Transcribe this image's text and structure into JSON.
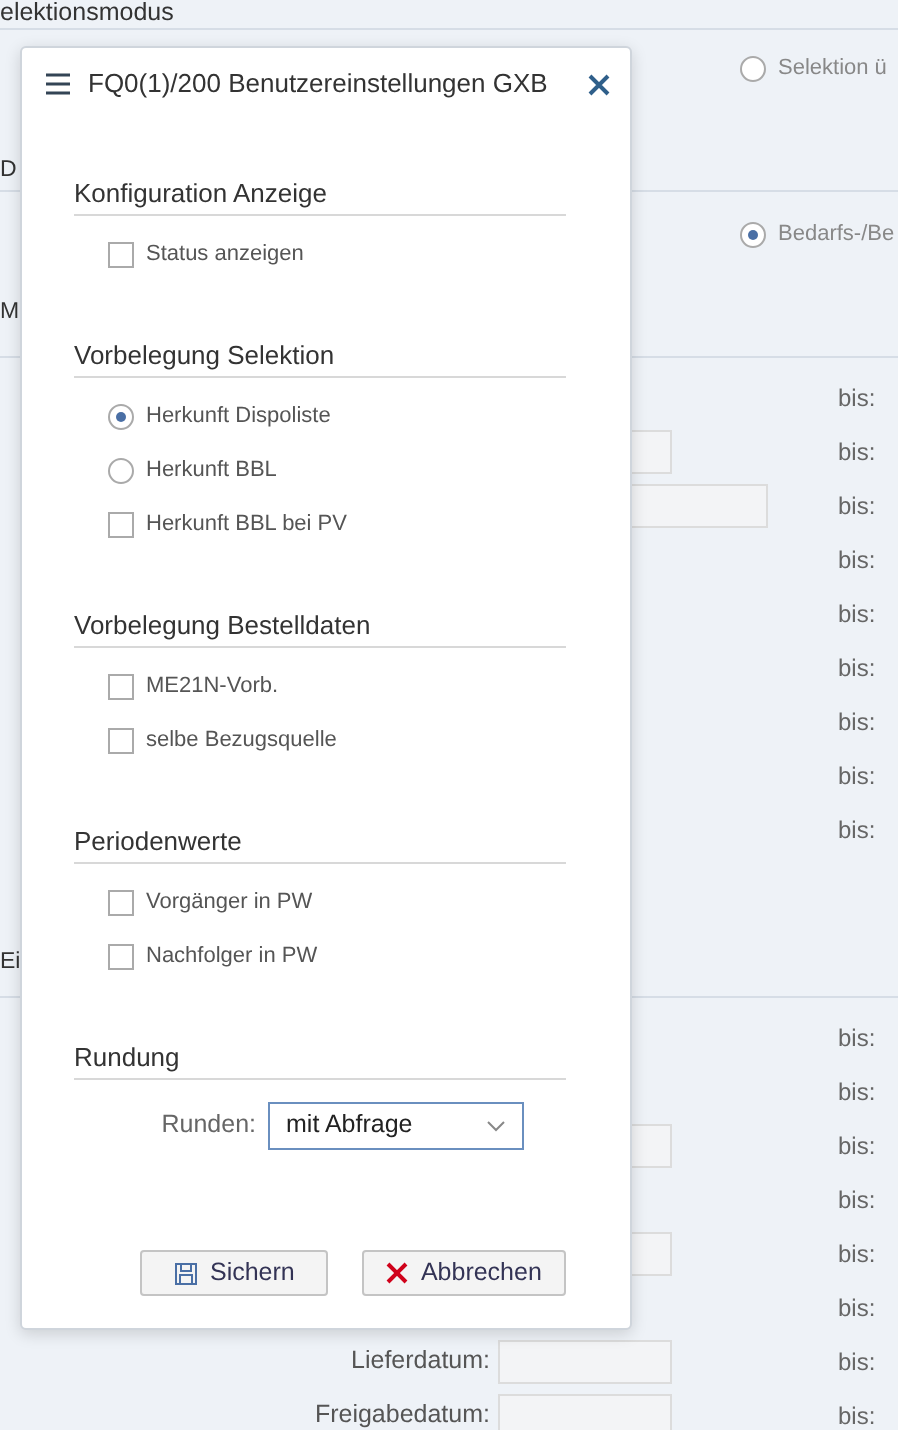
{
  "background": {
    "title": "elektionsmodus",
    "side_labels": [
      "D",
      "M",
      "Ei"
    ],
    "radios": [
      {
        "label": "Selektion ü",
        "selected": false
      },
      {
        "label": "Bedarfs-/Be",
        "selected": true
      }
    ],
    "rows_1": [
      {
        "to": "bis:"
      },
      {
        "to": "bis:",
        "kind": "short_field"
      },
      {
        "to": "bis:",
        "kind": "long_field"
      },
      {
        "to": "bis:"
      },
      {
        "to": "bis:"
      },
      {
        "to": "bis:"
      },
      {
        "to": "bis:"
      },
      {
        "to": "bis:"
      },
      {
        "to": "bis:"
      }
    ],
    "rows_2": [
      {
        "to": "bis:"
      },
      {
        "to": "bis:"
      },
      {
        "to": "bis:",
        "kind": "short_field"
      },
      {
        "to": "bis:"
      },
      {
        "to": "bis:",
        "kind": "short_field"
      },
      {
        "to": "bis:"
      },
      {
        "label": "Lieferdatum:",
        "to": "bis:",
        "kind": "short_field"
      },
      {
        "label": "Freigabedatum:",
        "to": "bis:",
        "kind": "short_field"
      }
    ]
  },
  "dialog": {
    "title": "FQ0(1)/200 Benutzereinstellungen GXB",
    "sections": [
      {
        "heading": "Konfiguration Anzeige",
        "items": [
          {
            "kind": "checkbox",
            "label": "Status anzeigen",
            "checked": false
          }
        ]
      },
      {
        "heading": "Vorbelegung Selektion",
        "items": [
          {
            "kind": "radio",
            "label": "Herkunft Dispoliste",
            "selected": true
          },
          {
            "kind": "radio",
            "label": "Herkunft BBL",
            "selected": false
          },
          {
            "kind": "checkbox",
            "label": "Herkunft BBL bei PV",
            "checked": false
          }
        ]
      },
      {
        "heading": "Vorbelegung Bestelldaten",
        "items": [
          {
            "kind": "checkbox",
            "label": "ME21N-Vorb.",
            "checked": false
          },
          {
            "kind": "checkbox",
            "label": "selbe Bezugsquelle",
            "checked": false
          }
        ]
      },
      {
        "heading": "Periodenwerte",
        "items": [
          {
            "kind": "checkbox",
            "label": "Vorgänger in PW",
            "checked": false
          },
          {
            "kind": "checkbox",
            "label": "Nachfolger in PW",
            "checked": false
          }
        ]
      },
      {
        "heading": "Rundung",
        "items": [
          {
            "kind": "select",
            "label": "Runden:",
            "value": "mit Abfrage"
          }
        ]
      }
    ],
    "buttons": [
      {
        "kind": "save",
        "label": "Sichern"
      },
      {
        "kind": "cancel",
        "label": "Abbrechen"
      }
    ]
  }
}
